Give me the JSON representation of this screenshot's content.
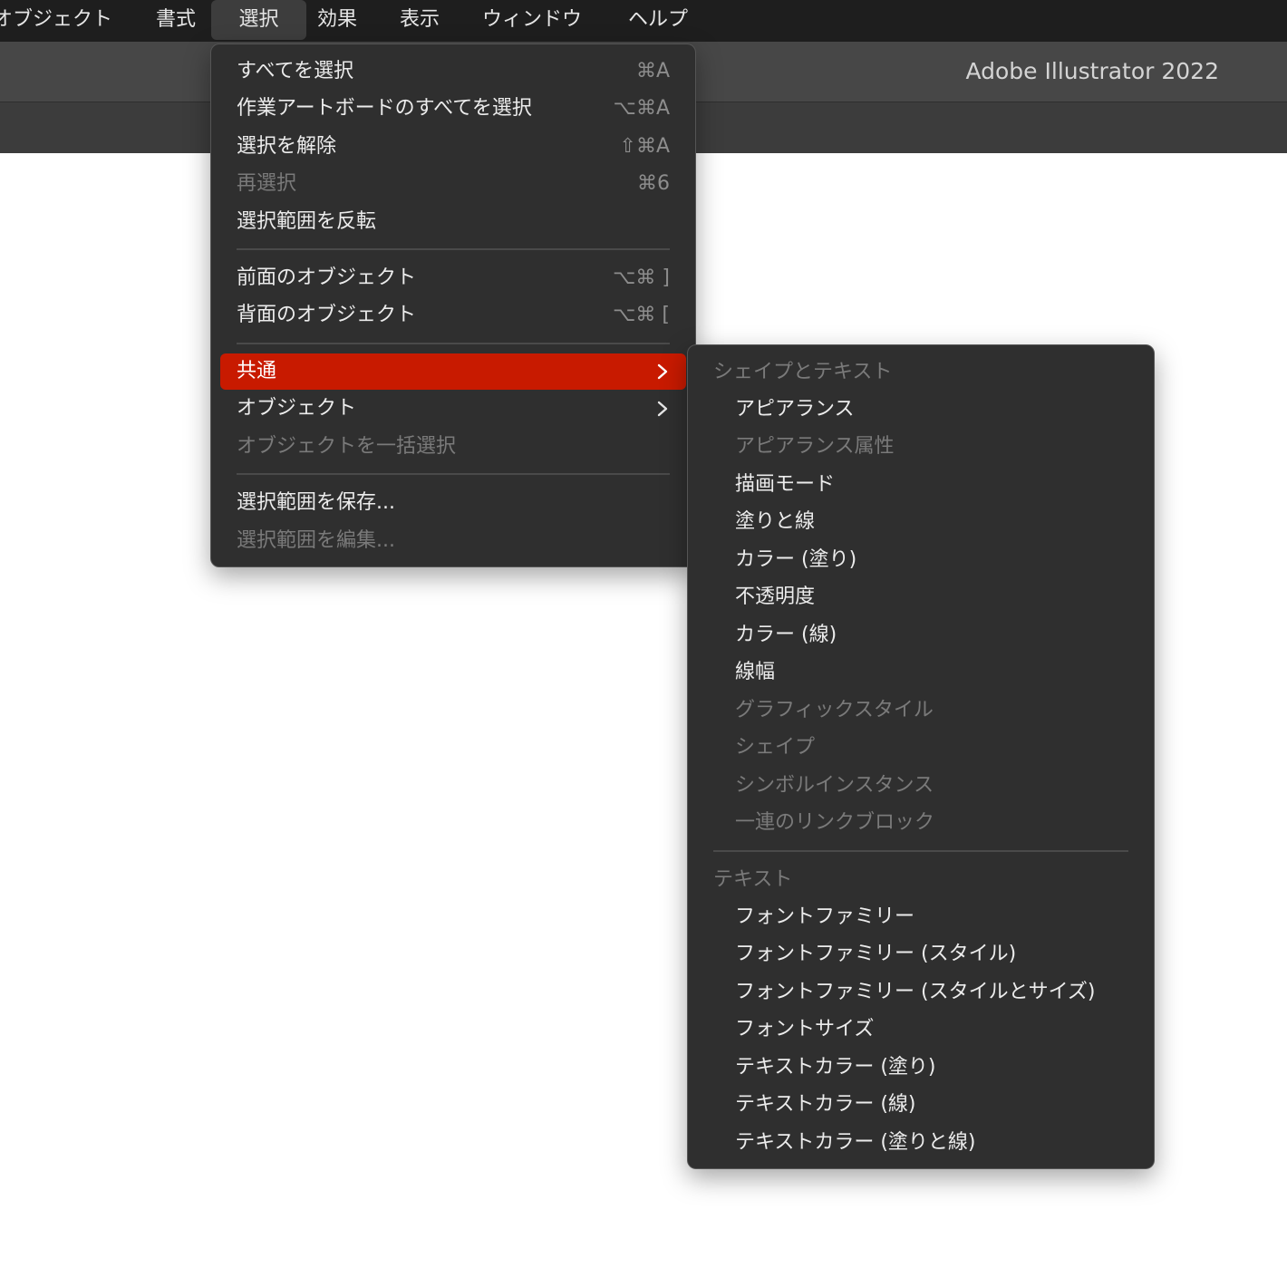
{
  "menubar": {
    "items": [
      "オブジェクト",
      "書式",
      "選択",
      "効果",
      "表示",
      "ウィンドウ",
      "ヘルプ"
    ]
  },
  "title": "Adobe Illustrator 2022",
  "select_menu": {
    "items": [
      {
        "label": "すべてを選択",
        "shortcut": "⌘A",
        "disabled": false
      },
      {
        "label": "作業アートボードのすべてを選択",
        "shortcut": "⌥⌘A",
        "disabled": false
      },
      {
        "label": "選択を解除",
        "shortcut": "⇧⌘A",
        "disabled": false
      },
      {
        "label": "再選択",
        "shortcut": "⌘6",
        "disabled": true
      },
      {
        "label": "選択範囲を反転",
        "shortcut": "",
        "disabled": false
      },
      {
        "label": "前面のオブジェクト",
        "shortcut": "⌥⌘ ]",
        "disabled": false
      },
      {
        "label": "背面のオブジェクト",
        "shortcut": "⌥⌘ [",
        "disabled": false
      },
      {
        "label": "共通",
        "submenu": true,
        "highlighted": true
      },
      {
        "label": "オブジェクト",
        "submenu": true
      },
      {
        "label": "オブジェクトを一括選択",
        "disabled": true
      },
      {
        "label": "選択範囲を保存...",
        "disabled": false
      },
      {
        "label": "選択範囲を編集...",
        "disabled": true
      }
    ]
  },
  "common_submenu": {
    "shape_text_header": "シェイプとテキスト",
    "shape_items": [
      {
        "label": "アピアランス",
        "disabled": false
      },
      {
        "label": "アピアランス属性",
        "disabled": true
      },
      {
        "label": "描画モード",
        "disabled": false
      },
      {
        "label": "塗りと線",
        "disabled": false
      },
      {
        "label": "カラー (塗り)",
        "disabled": false
      },
      {
        "label": "不透明度",
        "disabled": false
      },
      {
        "label": "カラー (線)",
        "disabled": false
      },
      {
        "label": "線幅",
        "disabled": false
      },
      {
        "label": "グラフィックスタイル",
        "disabled": true
      },
      {
        "label": "シェイプ",
        "disabled": true
      },
      {
        "label": "シンボルインスタンス",
        "disabled": true
      },
      {
        "label": "一連のリンクブロック",
        "disabled": true
      }
    ],
    "text_header": "テキスト",
    "text_items": [
      {
        "label": "フォントファミリー",
        "disabled": false
      },
      {
        "label": "フォントファミリー (スタイル)",
        "disabled": false
      },
      {
        "label": "フォントファミリー (スタイルとサイズ)",
        "disabled": false
      },
      {
        "label": "フォントサイズ",
        "disabled": false
      },
      {
        "label": "テキストカラー (塗り)",
        "disabled": false
      },
      {
        "label": "テキストカラー (線)",
        "disabled": false
      },
      {
        "label": "テキストカラー (塗りと線)",
        "disabled": false
      }
    ]
  },
  "colors": {
    "highlight": "#c81a00",
    "menu_bg": "#2f2f2f",
    "menubar_bg": "#1e1e1e"
  }
}
